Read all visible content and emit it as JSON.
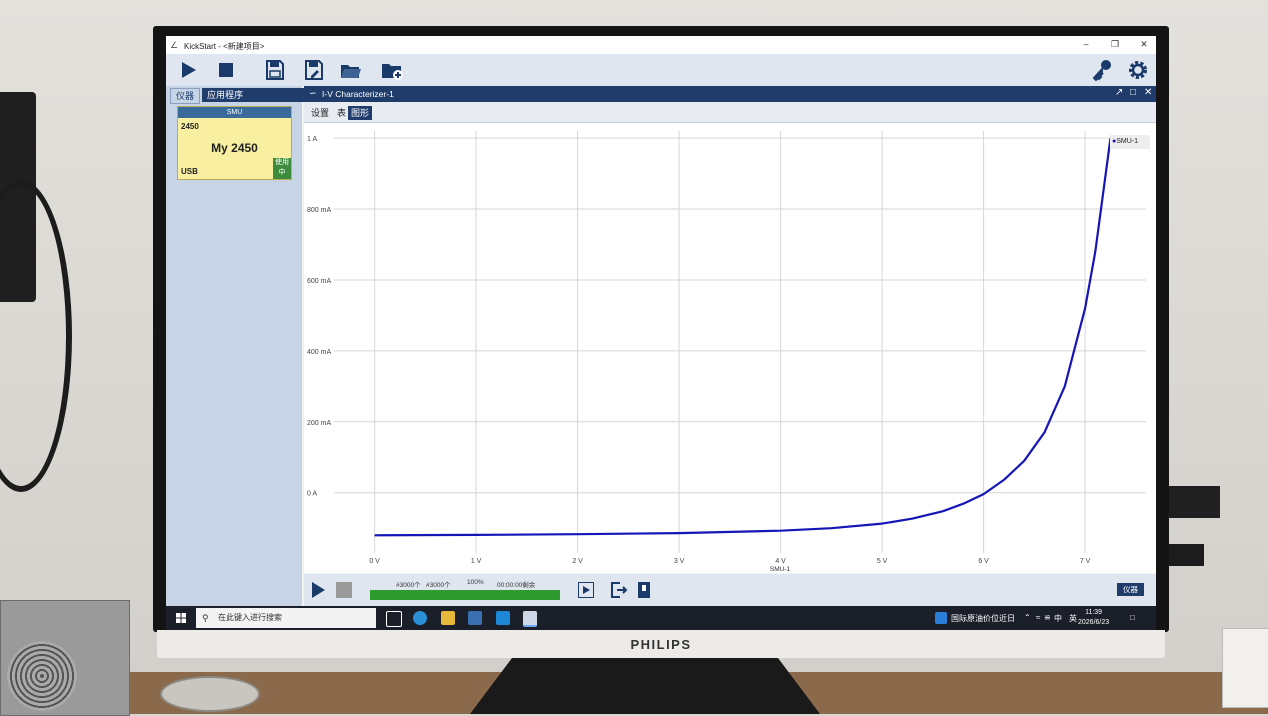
{
  "window": {
    "title": "KickStart - <新建项目>"
  },
  "left_panel": {
    "tabs": [
      "仪器",
      "应用程序"
    ],
    "instrument": {
      "type": "SMU",
      "model": "2450",
      "name": "My 2450",
      "connection": "USB",
      "status": "使用中"
    }
  },
  "document": {
    "title": "I-V Characterizer-1",
    "tabs": [
      "设置",
      "表",
      "图形"
    ],
    "selected_tab": "图形"
  },
  "chart_data": {
    "type": "line",
    "xlabel": "SMU-1",
    "ylabel": "",
    "x_ticks": [
      "0 V",
      "1 V",
      "2 V",
      "3 V",
      "4 V",
      "5 V",
      "6 V",
      "7 V"
    ],
    "y_ticks": [
      "0 A",
      "200 mA",
      "400 mA",
      "600 mA",
      "800 mA",
      "1 A"
    ],
    "xlim": [
      -0.4,
      7.6
    ],
    "ylim": [
      -0.17,
      1.02
    ],
    "grid": true,
    "legend_position": "top-right",
    "series": [
      {
        "name": "SMU-1",
        "color": "#1515b8",
        "x": [
          0,
          1,
          2,
          3,
          4,
          4.5,
          5,
          5.3,
          5.6,
          5.8,
          6.0,
          6.2,
          6.4,
          6.6,
          6.8,
          7.0,
          7.1,
          7.25
        ],
        "y": [
          -0.12,
          -0.119,
          -0.117,
          -0.114,
          -0.107,
          -0.1,
          -0.087,
          -0.073,
          -0.052,
          -0.031,
          -0.004,
          0.036,
          0.09,
          0.17,
          0.3,
          0.52,
          0.68,
          1.0
        ]
      }
    ]
  },
  "controls": {
    "count_done": "#3000个",
    "count_total": "#3000个",
    "percent": "100%",
    "remaining": "00:00:00剩余",
    "instrument_button": "仪器"
  },
  "taskbar": {
    "search_placeholder": "在此键入进行搜索",
    "news": "国际原油价位近日",
    "ime_zh": "中",
    "ime_en": "英",
    "time": "11:39",
    "date": "2026/6/23"
  },
  "monitor": {
    "brand": "PHILIPS"
  }
}
